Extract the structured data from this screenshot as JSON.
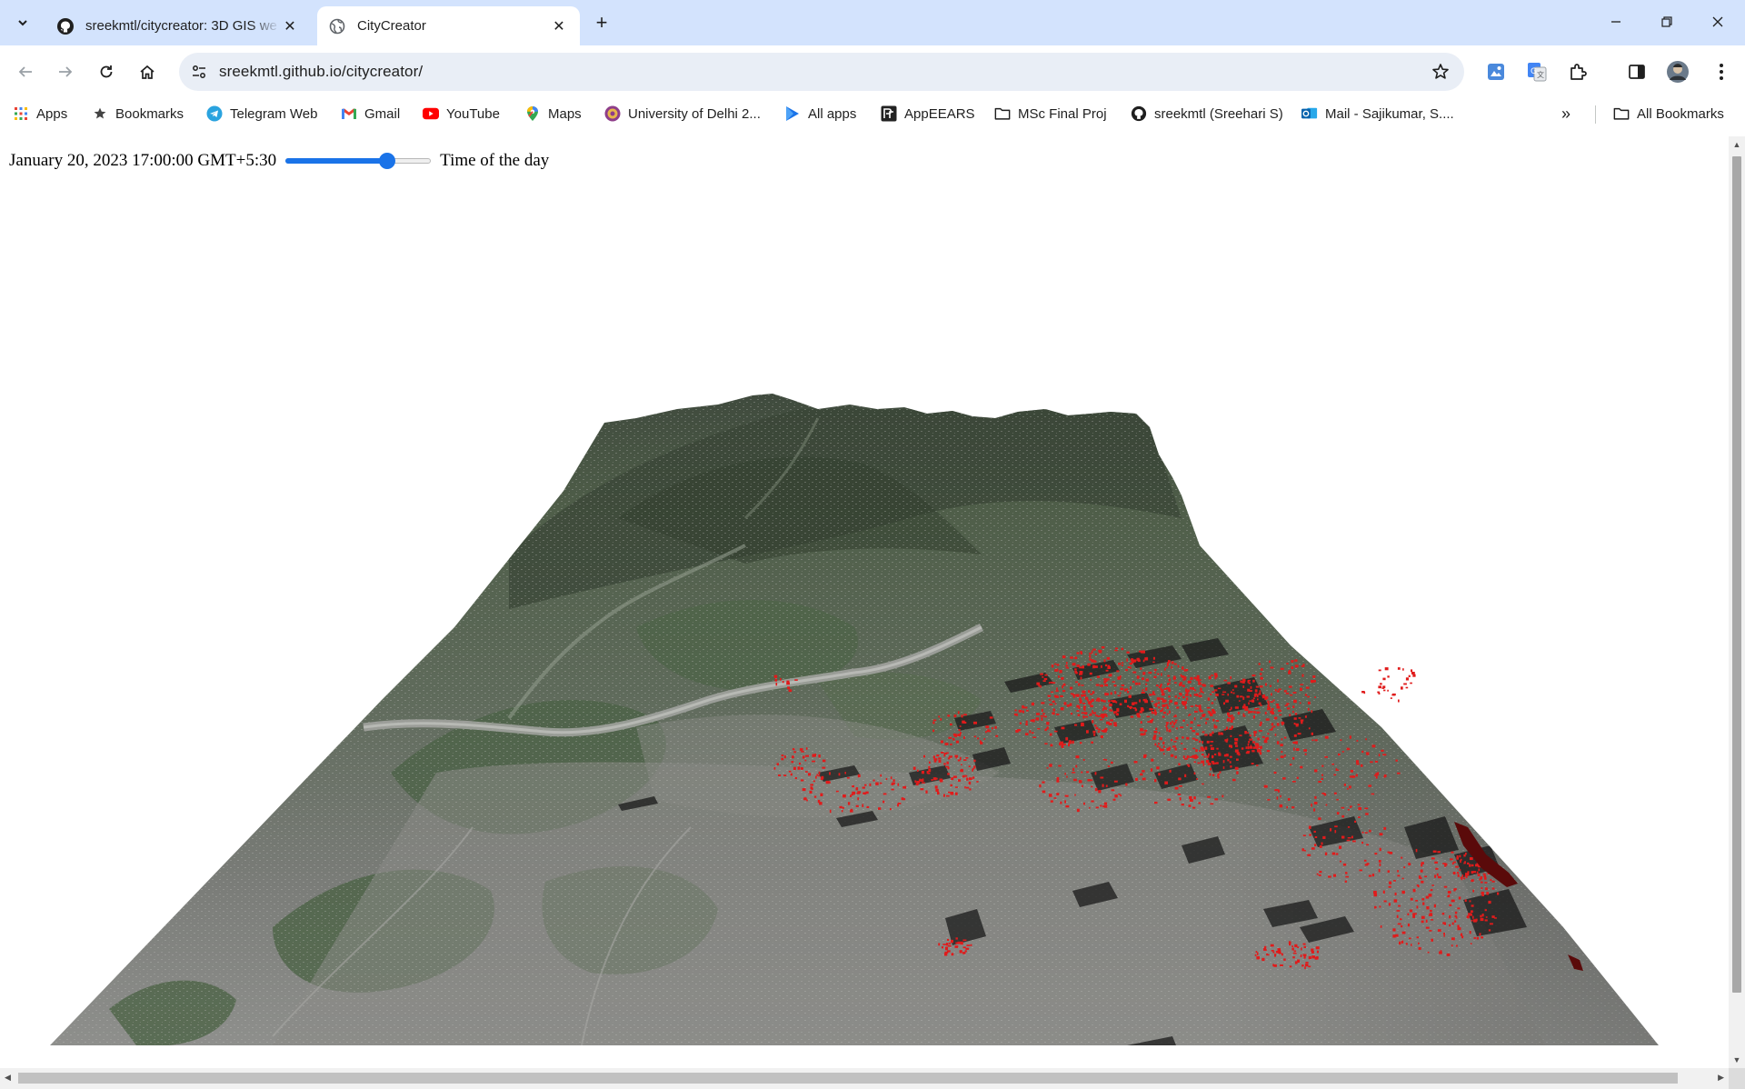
{
  "browser": {
    "tabs": [
      {
        "title": "sreekmtl/citycreator: 3D GIS we",
        "favicon": "github-icon",
        "active": false
      },
      {
        "title": "CityCreator",
        "favicon": "globe-icon",
        "active": true
      }
    ],
    "address": {
      "url": "sreekmtl.github.io/citycreator/"
    },
    "bookmarks": [
      {
        "label": "Apps",
        "icon": "apps-grid-icon"
      },
      {
        "label": "Bookmarks",
        "icon": "star-icon"
      },
      {
        "label": "Telegram Web",
        "icon": "telegram-icon"
      },
      {
        "label": "Gmail",
        "icon": "gmail-icon"
      },
      {
        "label": "YouTube",
        "icon": "youtube-icon"
      },
      {
        "label": "Maps",
        "icon": "maps-pin-icon"
      },
      {
        "label": "University of Delhi 2...",
        "icon": "university-icon"
      },
      {
        "label": "All apps",
        "icon": "all-apps-icon"
      },
      {
        "label": "AppEEARS",
        "icon": "appeears-icon"
      },
      {
        "label": "MSc Final Proj",
        "icon": "folder-icon"
      },
      {
        "label": "sreekmtl (Sreehari S)",
        "icon": "github-icon"
      },
      {
        "label": "Mail - Sajikumar, S....",
        "icon": "outlook-icon"
      }
    ],
    "all_bookmarks": "All Bookmarks",
    "colors": {
      "tabstrip": "#d3e3fd",
      "omnibox": "#e9eef6",
      "accent": "#1a73e8"
    }
  },
  "page": {
    "datetime": "January 20, 2023 17:00:00 GMT+5:30",
    "slider": {
      "fraction": 0.7
    },
    "slider_label": "Time of the day"
  }
}
